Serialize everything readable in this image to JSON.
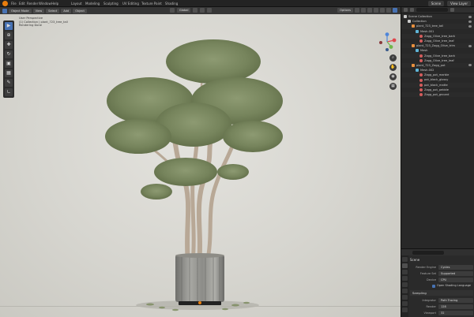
{
  "topbar": {
    "menus": [
      "File",
      "Edit",
      "Render",
      "Window",
      "Help",
      "Layout",
      "Modeling",
      "Sculpting",
      "UV Editing",
      "Texture Paint",
      "Shading"
    ],
    "scene_label": "Scene",
    "view_layer_label": "View Layer"
  },
  "viewport": {
    "header": {
      "mode": "Object Mode",
      "menus": [
        "View",
        "Select",
        "Add",
        "Object"
      ],
      "transform_orientation": "Global",
      "options_label": "Options"
    },
    "overlay": {
      "line1": "User Perspective",
      "line2": "(1) Collection | plant_723_tree_tall",
      "line3": "Rendering Done"
    },
    "nav_icons": [
      "zoom-icon",
      "hand-icon",
      "camera-icon",
      "grid-icon"
    ]
  },
  "outliner": {
    "title": "Scene Collection",
    "rows": [
      {
        "indent": 0,
        "icon": "coll",
        "label": "Scene Collection"
      },
      {
        "indent": 1,
        "icon": "coll",
        "label": "Collection"
      },
      {
        "indent": 2,
        "icon": "obj",
        "label": "plant_723_tree_tall"
      },
      {
        "indent": 3,
        "icon": "mesh",
        "label": "Mesh.001"
      },
      {
        "indent": 4,
        "icon": "mat",
        "label": "Zagg_Olive_tree_bark"
      },
      {
        "indent": 4,
        "icon": "mat",
        "label": "Zagg_Olive_tree_leaf"
      },
      {
        "indent": 2,
        "icon": "obj",
        "label": "plant_723_Zagg_Olive_trim"
      },
      {
        "indent": 3,
        "icon": "mesh",
        "label": "Mesh"
      },
      {
        "indent": 4,
        "icon": "mat",
        "label": "Zagg_Olive_tree_bark"
      },
      {
        "indent": 4,
        "icon": "mat",
        "label": "Zagg_Olive_tree_leaf"
      },
      {
        "indent": 2,
        "icon": "obj",
        "label": "plant_723_Zagg_pot"
      },
      {
        "indent": 3,
        "icon": "mesh",
        "label": "Mesh.002"
      },
      {
        "indent": 4,
        "icon": "mat",
        "label": "Zagg_pot_marble"
      },
      {
        "indent": 4,
        "icon": "mat",
        "label": "pot_black_glossy"
      },
      {
        "indent": 4,
        "icon": "mat",
        "label": "pot_black_matte"
      },
      {
        "indent": 4,
        "icon": "mat",
        "label": "Zagg_pot_pebble"
      },
      {
        "indent": 4,
        "icon": "mat",
        "label": "Zagg_pot_ground"
      }
    ]
  },
  "properties": {
    "scene_title": "Scene",
    "render_engine_label": "Render Engine",
    "render_engine_value": "Cycles",
    "feature_set_label": "Feature Set",
    "feature_set_value": "Supported",
    "device_label": "Device",
    "device_value": "CPU",
    "osl_label": "Open Shading Language",
    "sampling_section": "Sampling",
    "integrator_label": "Integrator",
    "integrator_value": "Path Tracing",
    "render_label": "Render",
    "render_value": "128",
    "viewport_label": "Viewport",
    "viewport_value": "32"
  }
}
